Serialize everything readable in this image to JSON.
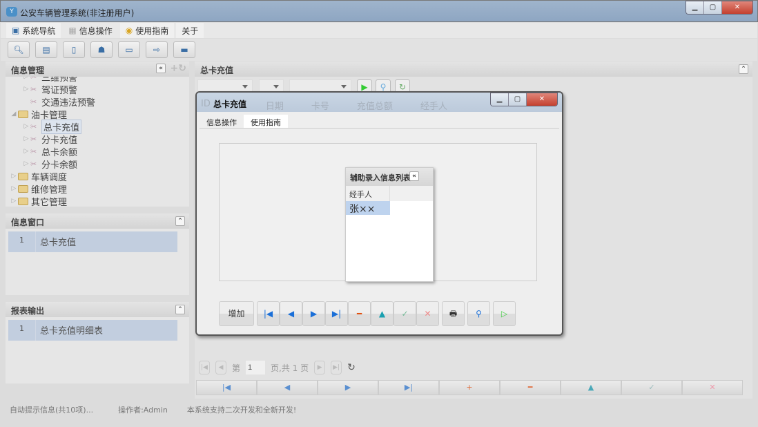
{
  "window": {
    "title": "公安车辆管理系统(非注册用户)",
    "logo": "Y"
  },
  "menu": [
    "系统导航",
    "信息操作",
    "使用指南",
    "关于"
  ],
  "toolbar_icons": [
    "search-icon",
    "list-icon",
    "document-icon",
    "user-config-icon",
    "monitor-icon",
    "export-icon",
    "window-icon"
  ],
  "left": {
    "tree_title": "信息管理",
    "tree": [
      {
        "label": "三维预警",
        "level": 2,
        "clipped": true
      },
      {
        "label": "驾证预警",
        "level": 2
      },
      {
        "label": "交通违法预警",
        "level": 2
      },
      {
        "label": "油卡管理",
        "level": 1,
        "expanded": true
      },
      {
        "label": "总卡充值",
        "level": 2,
        "selected": true
      },
      {
        "label": "分卡充值",
        "level": 2
      },
      {
        "label": "总卡余额",
        "level": 2
      },
      {
        "label": "分卡余额",
        "level": 2
      },
      {
        "label": "车辆调度",
        "level": 1
      },
      {
        "label": "维修管理",
        "level": 1
      },
      {
        "label": "其它管理",
        "level": 1
      }
    ],
    "info_title": "信息窗口",
    "info_rows": [
      {
        "n": "1",
        "label": "总卡充值"
      }
    ],
    "report_title": "报表输出",
    "report_rows": [
      {
        "n": "1",
        "label": "总卡充值明细表"
      }
    ]
  },
  "main": {
    "title": "总卡充值",
    "grid_columns": [
      "ID",
      "日期",
      "卡号",
      "充值总额",
      "经手人"
    ],
    "pager": {
      "page_label": "第",
      "page": "1",
      "total_label": "页,共 1 页"
    },
    "nav_buttons": [
      "first",
      "prev",
      "next",
      "last",
      "add",
      "remove",
      "up",
      "confirm",
      "cancel"
    ]
  },
  "dialog": {
    "title": "总卡充值",
    "tabs": [
      "信息操作",
      "使用指南"
    ],
    "popup": {
      "title": "辅助录入信息列表",
      "column": "经手人",
      "rows": [
        "张××"
      ]
    },
    "add_label": "增加"
  },
  "status": {
    "hint": "自动提示信息(共10项)...",
    "operator": "操作者:Admin",
    "note": "本系统支持二次开发和全新开发!"
  }
}
